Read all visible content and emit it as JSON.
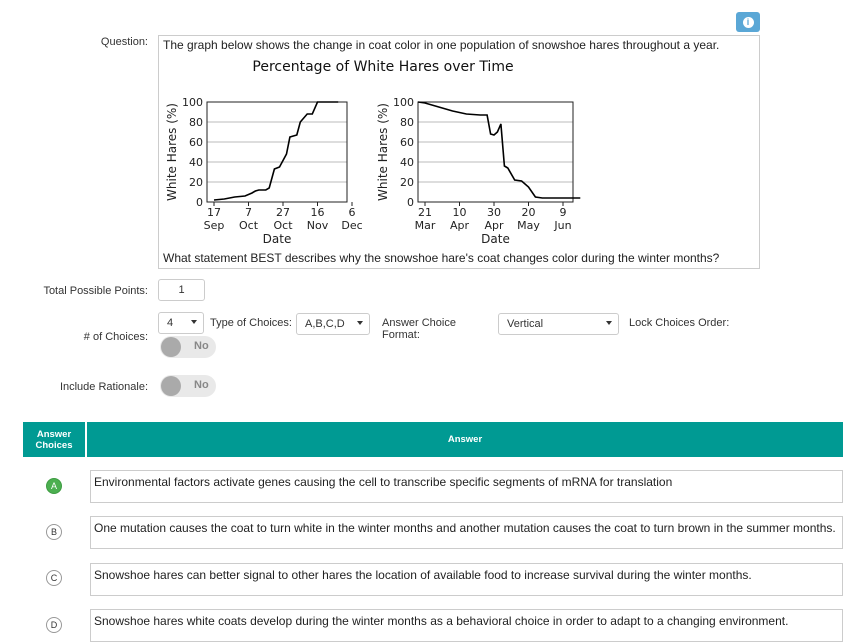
{
  "info_button": {
    "icon": "info-icon",
    "glyph": "i"
  },
  "question": {
    "label": "Question:",
    "intro": "The graph below shows the change in coat color in one population of snowshoe hares throughout a year.",
    "prompt": "What statement BEST describes why the snowshoe hare's coat changes color during the winter months?"
  },
  "chart_data": [
    {
      "type": "line",
      "title": "Percentage of White Hares over Time",
      "ylabel": "White Hares (%)",
      "xlabel": "Date",
      "ylim": [
        0,
        100
      ],
      "yticks": [
        "0",
        "20",
        "40",
        "60",
        "80",
        "100"
      ],
      "xticks": [
        {
          "day": "17",
          "month": "Sep"
        },
        {
          "day": "7",
          "month": "Oct"
        },
        {
          "day": "27",
          "month": "Oct"
        },
        {
          "day": "16",
          "month": "Nov"
        },
        {
          "day": "6",
          "month": "Dec"
        }
      ],
      "grid": true,
      "series": [
        {
          "x": [
            0,
            0.3,
            0.6,
            0.9,
            1.1,
            1.2,
            1.3,
            1.5,
            1.6,
            1.75,
            1.9,
            2.1,
            2.2,
            2.4,
            2.5,
            2.7,
            2.85,
            3.0,
            3.2,
            3.6
          ],
          "y": [
            2,
            3,
            5,
            6,
            9,
            11,
            12,
            12,
            14,
            33,
            35,
            48,
            65,
            67,
            80,
            88,
            88,
            100,
            100,
            100
          ]
        }
      ]
    },
    {
      "type": "line",
      "title": "",
      "ylabel": "White Hares (%)",
      "xlabel": "Date",
      "ylim": [
        0,
        100
      ],
      "yticks": [
        "0",
        "20",
        "40",
        "60",
        "80",
        "100"
      ],
      "xticks": [
        {
          "day": "21",
          "month": "Mar"
        },
        {
          "day": "10",
          "month": "Apr"
        },
        {
          "day": "30",
          "month": "Apr"
        },
        {
          "day": "20",
          "month": "May"
        },
        {
          "day": "9",
          "month": "Jun"
        }
      ],
      "grid": true,
      "series": [
        {
          "x": [
            -0.3,
            0,
            0.4,
            0.8,
            1.2,
            1.6,
            1.8,
            1.9,
            2.0,
            2.1,
            2.2,
            2.3,
            2.35,
            2.4,
            2.6,
            2.8,
            3.0,
            3.2,
            3.4,
            4.0,
            4.5
          ],
          "y": [
            100,
            99,
            95,
            91,
            88,
            87,
            87,
            68,
            67,
            70,
            78,
            36,
            35,
            34,
            22,
            21,
            15,
            5,
            4,
            4,
            4
          ]
        }
      ]
    }
  ],
  "settings": {
    "total_points_label": "Total Possible Points:",
    "total_points_value": "1",
    "num_choices_label": "# of Choices:",
    "num_choices_value": "4",
    "type_of_choices_label": "Type of Choices:",
    "type_of_choices_value": "A,B,C,D",
    "answer_format_label": "Answer Choice Format:",
    "answer_format_value": "Vertical",
    "lock_order_label": "Lock Choices Order:",
    "lock_toggle": "No",
    "include_rationale_label": "Include Rationale:",
    "rationale_toggle": "No"
  },
  "table": {
    "col1": "Answer Choices",
    "col2": "Answer",
    "header_color": "#009a93",
    "correct_color": "#4caf50",
    "choices": [
      {
        "letter": "A",
        "text": "Environmental factors activate genes causing the cell to transcribe specific segments of mRNA for translation",
        "correct": true
      },
      {
        "letter": "B",
        "text": "One mutation causes the coat to turn white in the winter months and another mutation causes the coat to turn brown in the summer months.",
        "correct": false
      },
      {
        "letter": "C",
        "text": "Snowshoe hares can better signal to other hares the location of available food to increase survival during the winter months.",
        "correct": false
      },
      {
        "letter": "D",
        "text": "Snowshoe hares white coats develop during the winter months as a behavioral choice in order to adapt to a changing environment.",
        "correct": false
      }
    ]
  }
}
